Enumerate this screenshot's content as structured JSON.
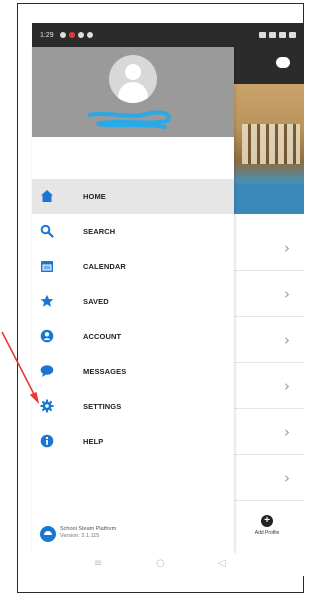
{
  "statusbar": {
    "time": "1:29"
  },
  "drawer": {
    "menu": [
      {
        "label": "HOME",
        "icon": "home-icon",
        "active": true
      },
      {
        "label": "SEARCH",
        "icon": "search-icon",
        "active": false
      },
      {
        "label": "CALENDAR",
        "icon": "calendar-icon",
        "active": false
      },
      {
        "label": "SAVED",
        "icon": "star-icon",
        "active": false
      },
      {
        "label": "ACCOUNT",
        "icon": "account-icon",
        "active": false
      },
      {
        "label": "MESSAGES",
        "icon": "chat-bubble-icon",
        "active": false
      },
      {
        "label": "SETTINGS",
        "icon": "gear-icon",
        "active": false
      },
      {
        "label": "HELP",
        "icon": "info-icon",
        "active": false
      }
    ],
    "footer": {
      "app_name": "School Steam Platform",
      "version": "Version: 2.1.115"
    }
  },
  "background": {
    "add_profile_label": "Add Profile"
  },
  "colors": {
    "accent": "#1976d2",
    "header": "#9a9a9a",
    "annotation_arrow": "#e53935"
  }
}
